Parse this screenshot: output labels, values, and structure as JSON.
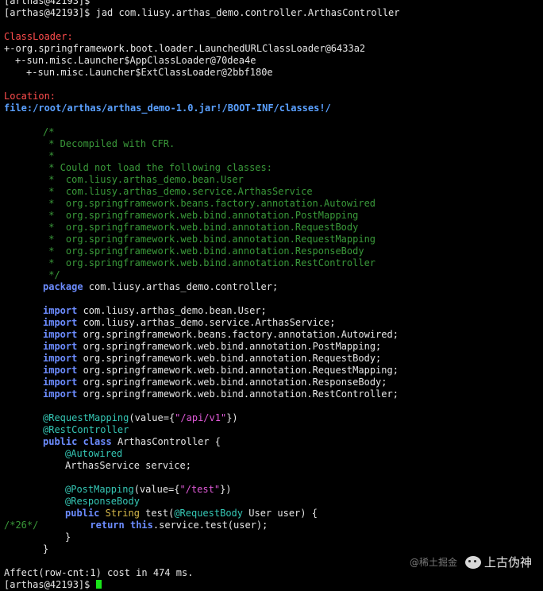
{
  "terminal": {
    "prompt_prev": "[arthas@42193]$",
    "command_line": "[arthas@42193]$ jad com.liusy.arthas_demo.controller.ArthasController",
    "classloader_label": "ClassLoader:",
    "classloader_lines": [
      "+-org.springframework.boot.loader.LaunchedURLClassLoader@6433a2",
      "+-sun.misc.Launcher$AppClassLoader@70dea4e",
      "+-sun.misc.Launcher$ExtClassLoader@2bbf180e"
    ],
    "location_label": "Location:",
    "location_value": "file:/root/arthas/arthas_demo-1.0.jar!/BOOT-INF/classes!/",
    "comment_lines": [
      "/*",
      " * Decompiled with CFR.",
      " *",
      " * Could not load the following classes:",
      " *  com.liusy.arthas_demo.bean.User",
      " *  com.liusy.arthas_demo.service.ArthasService",
      " *  org.springframework.beans.factory.annotation.Autowired",
      " *  org.springframework.web.bind.annotation.PostMapping",
      " *  org.springframework.web.bind.annotation.RequestBody",
      " *  org.springframework.web.bind.annotation.RequestMapping",
      " *  org.springframework.web.bind.annotation.ResponseBody",
      " *  org.springframework.web.bind.annotation.RestController",
      " */"
    ],
    "kw_package": "package",
    "package_name": " com.liusy.arthas_demo.controller;",
    "kw_import": "import",
    "imports": [
      " com.liusy.arthas_demo.bean.User;",
      " com.liusy.arthas_demo.service.ArthasService;",
      " org.springframework.beans.factory.annotation.Autowired;",
      " org.springframework.web.bind.annotation.PostMapping;",
      " org.springframework.web.bind.annotation.RequestBody;",
      " org.springframework.web.bind.annotation.RequestMapping;",
      " org.springframework.web.bind.annotation.ResponseBody;",
      " org.springframework.web.bind.annotation.RestController;"
    ],
    "ann_request_mapping": "@RequestMapping",
    "req_mapping_open": "(value={",
    "req_mapping_value": "\"/api/v1\"",
    "req_mapping_close": "})",
    "ann_rest_controller": "@RestController",
    "kw_public": "public",
    "kw_class": "class",
    "class_decl_rest": " ArthasController {",
    "ann_autowired": "@Autowired",
    "field_decl": "ArthasService service;",
    "ann_post_mapping": "@PostMapping",
    "post_mapping_open": "(value={",
    "post_mapping_value": "\"/test\"",
    "post_mapping_close": "})",
    "ann_response_body": "@ResponseBody",
    "type_string": "String",
    "method_name": " test(",
    "ann_request_body": "@RequestBody",
    "method_params": " User user) {",
    "line_marker": "/*26*/",
    "kw_return": "return",
    "kw_this": "this",
    "return_rest": ".service.test(user);",
    "close_brace": "}",
    "affect_line": "Affect(row-cnt:1) cost in 474 ms.",
    "prompt_final": "[arthas@42193]$ "
  },
  "watermark": {
    "faint_text": "@稀土掘金",
    "name": "上古伪神"
  }
}
